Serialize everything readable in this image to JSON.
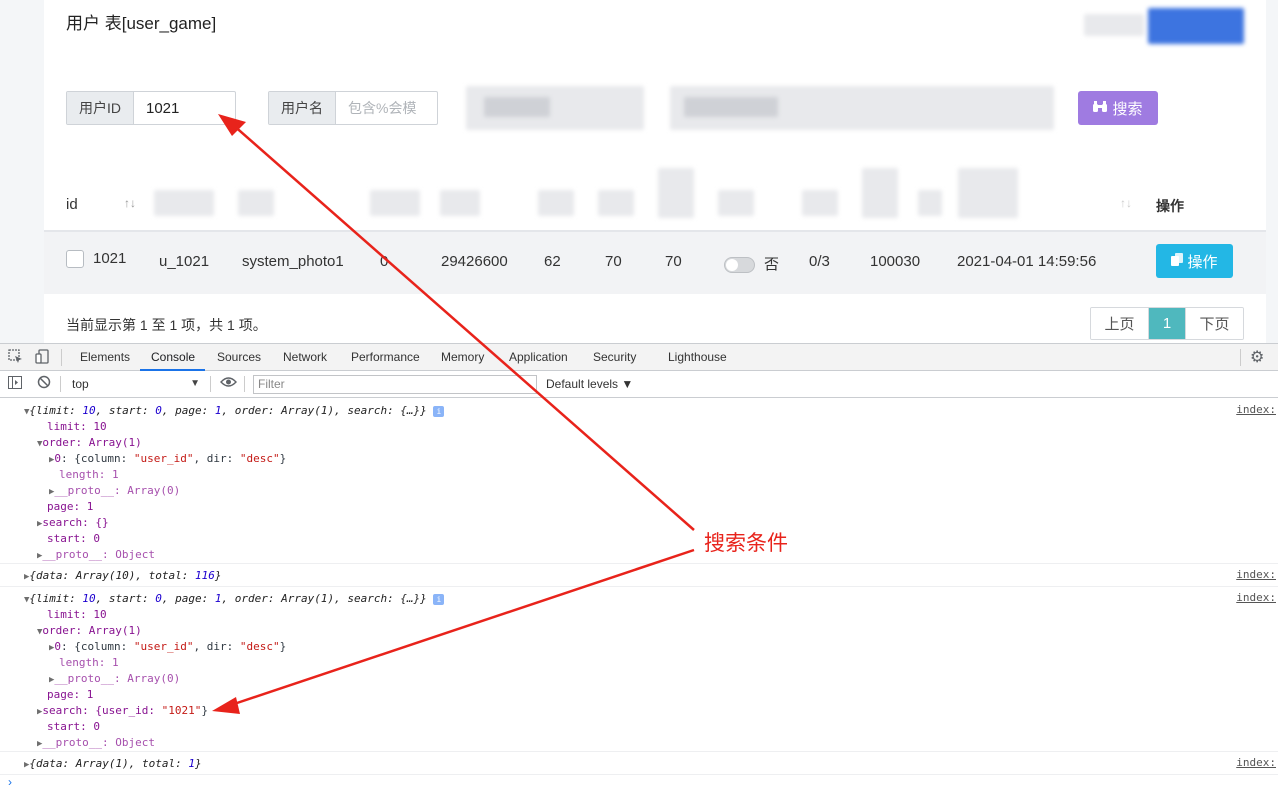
{
  "page": {
    "title": "用户 表[user_game]"
  },
  "filters": {
    "user_id_label": "用户ID",
    "user_id_value": "1021",
    "username_label": "用户名",
    "username_placeholder": "包含%会模",
    "search_button": "搜索"
  },
  "table": {
    "col_id": "id",
    "col_ops": "操作",
    "sort_glyph": "↑↓",
    "row": {
      "id": "1021",
      "username": "u_1021",
      "photo": "system_photo1",
      "c4": "0",
      "c5": "29426600",
      "c6": "62",
      "c7": "70",
      "c8": "70",
      "toggle_label": "否",
      "c10": "0/3",
      "c11": "100030",
      "created": "2021-04-01 14:59:56",
      "op_button": "操作"
    }
  },
  "footer": {
    "info": "当前显示第 1 至 1 项，共 1 项。",
    "prev": "上页",
    "current": "1",
    "next": "下页"
  },
  "devtools": {
    "tabs": [
      "Elements",
      "Console",
      "Sources",
      "Network",
      "Performance",
      "Memory",
      "Application",
      "Security",
      "Lighthouse"
    ],
    "active_tab": "Console",
    "context": "top",
    "filter_placeholder": "Filter",
    "levels": "Default levels ▼",
    "source_link": "index:",
    "log1": {
      "summary_pre": "{limit: ",
      "limit": "10",
      "mid1": ", start: ",
      "start": "0",
      "mid2": ", page: ",
      "page": "1",
      "mid3": ", order: Array(1), search: {…}}",
      "limit_line": "limit: 10",
      "order_line": "order: Array(1)",
      "order0_pre": "0: {column: ",
      "order0_col": "\"user_id\"",
      "order0_mid": ", dir: ",
      "order0_dir": "\"desc\"",
      "order0_end": "}",
      "length_line": "length: 1",
      "proto_arr": "__proto__: Array(0)",
      "page_line": "page: 1",
      "search_line": "search: {}",
      "start_line": "start: 0",
      "proto_obj": "__proto__: Object"
    },
    "result1": {
      "pre": "{data: Array(10), total: ",
      "total": "116",
      "end": "}"
    },
    "log2": {
      "search_pre": "search: {user_id: ",
      "search_val": "\"1021\"",
      "search_end": "}"
    },
    "result2": {
      "pre": "{data: Array(1), total: ",
      "total": "1",
      "end": "}"
    }
  },
  "annotation": {
    "label": "搜索条件",
    "color": "#e8231b"
  }
}
